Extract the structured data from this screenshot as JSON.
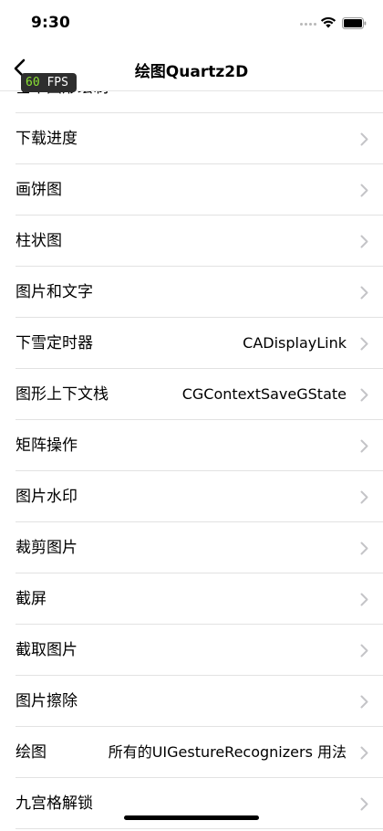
{
  "status_bar": {
    "time": "9:30"
  },
  "nav": {
    "title": "绘图Quartz2D",
    "fps_value": "60",
    "fps_unit": "FPS"
  },
  "list": {
    "partial_row_title": "基本图形绘制",
    "rows": [
      {
        "title": "下载进度",
        "detail": ""
      },
      {
        "title": "画饼图",
        "detail": ""
      },
      {
        "title": "柱状图",
        "detail": ""
      },
      {
        "title": "图片和文字",
        "detail": ""
      },
      {
        "title": "下雪定时器",
        "detail": "CADisplayLink"
      },
      {
        "title": "图形上下文栈",
        "detail": "CGContextSaveGState"
      },
      {
        "title": "矩阵操作",
        "detail": ""
      },
      {
        "title": "图片水印",
        "detail": ""
      },
      {
        "title": "裁剪图片",
        "detail": ""
      },
      {
        "title": "截屏",
        "detail": ""
      },
      {
        "title": "截取图片",
        "detail": ""
      },
      {
        "title": "图片擦除",
        "detail": ""
      },
      {
        "title": "绘图",
        "detail": "所有的UIGestureRecognizers 用法"
      },
      {
        "title": "九宫格解锁",
        "detail": ""
      }
    ]
  }
}
